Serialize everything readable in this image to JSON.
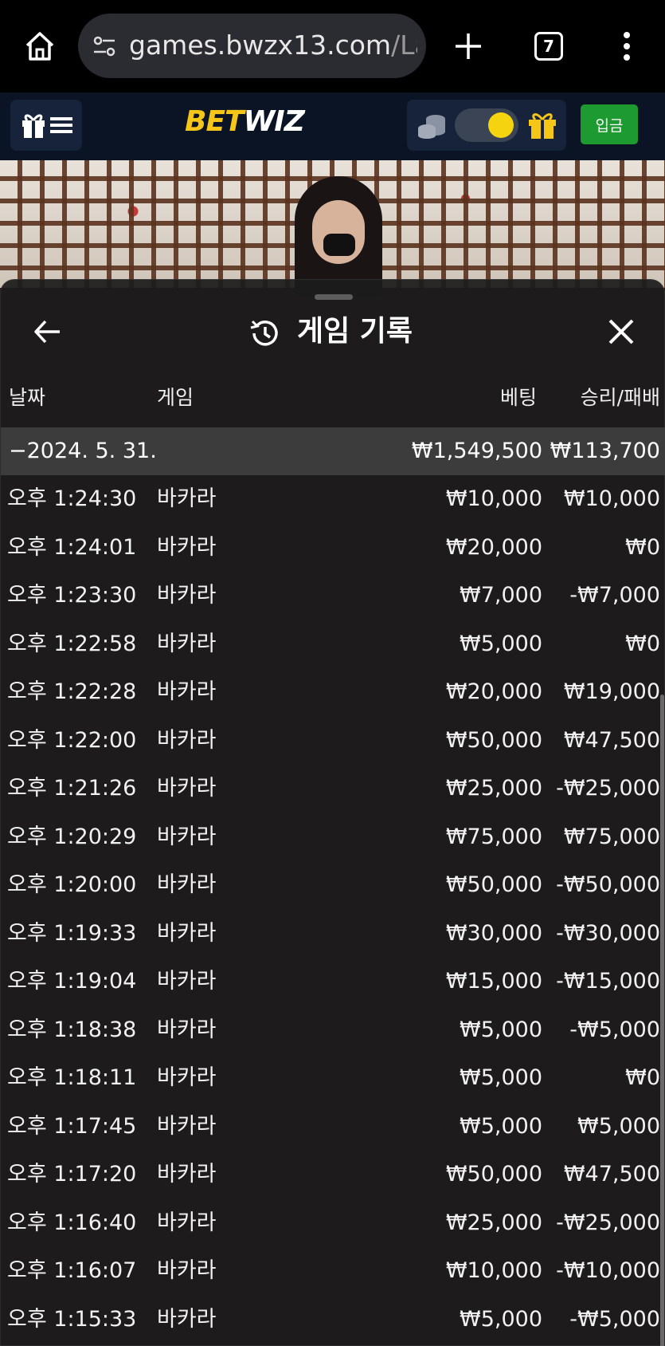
{
  "browser": {
    "url_main": "games.bwzx13.com",
    "url_rest": "/La",
    "tab_count": "7"
  },
  "site": {
    "logo_bet": "BET",
    "logo_wiz": "WIZ",
    "deposit_label": "입금"
  },
  "panel": {
    "title": "게임 기록",
    "headers": {
      "date": "날짜",
      "game": "게임",
      "bet": "베팅",
      "result": "승리/패배"
    },
    "summary": {
      "date": "−2024. 5. 31.",
      "bet": "₩1,549,500",
      "result": "₩113,700"
    },
    "rows": [
      {
        "time": "오후 1:24:30",
        "game": "바카라",
        "bet": "₩10,000",
        "result": "₩10,000"
      },
      {
        "time": "오후 1:24:01",
        "game": "바카라",
        "bet": "₩20,000",
        "result": "₩0"
      },
      {
        "time": "오후 1:23:30",
        "game": "바카라",
        "bet": "₩7,000",
        "result": "-₩7,000"
      },
      {
        "time": "오후 1:22:58",
        "game": "바카라",
        "bet": "₩5,000",
        "result": "₩0"
      },
      {
        "time": "오후 1:22:28",
        "game": "바카라",
        "bet": "₩20,000",
        "result": "₩19,000"
      },
      {
        "time": "오후 1:22:00",
        "game": "바카라",
        "bet": "₩50,000",
        "result": "₩47,500"
      },
      {
        "time": "오후 1:21:26",
        "game": "바카라",
        "bet": "₩25,000",
        "result": "-₩25,000"
      },
      {
        "time": "오후 1:20:29",
        "game": "바카라",
        "bet": "₩75,000",
        "result": "₩75,000"
      },
      {
        "time": "오후 1:20:00",
        "game": "바카라",
        "bet": "₩50,000",
        "result": "-₩50,000"
      },
      {
        "time": "오후 1:19:33",
        "game": "바카라",
        "bet": "₩30,000",
        "result": "-₩30,000"
      },
      {
        "time": "오후 1:19:04",
        "game": "바카라",
        "bet": "₩15,000",
        "result": "-₩15,000"
      },
      {
        "time": "오후 1:18:38",
        "game": "바카라",
        "bet": "₩5,000",
        "result": "-₩5,000"
      },
      {
        "time": "오후 1:18:11",
        "game": "바카라",
        "bet": "₩5,000",
        "result": "₩0"
      },
      {
        "time": "오후 1:17:45",
        "game": "바카라",
        "bet": "₩5,000",
        "result": "₩5,000"
      },
      {
        "time": "오후 1:17:20",
        "game": "바카라",
        "bet": "₩50,000",
        "result": "₩47,500"
      },
      {
        "time": "오후 1:16:40",
        "game": "바카라",
        "bet": "₩25,000",
        "result": "-₩25,000"
      },
      {
        "time": "오후 1:16:07",
        "game": "바카라",
        "bet": "₩10,000",
        "result": "-₩10,000"
      },
      {
        "time": "오후 1:15:33",
        "game": "바카라",
        "bet": "₩5,000",
        "result": "-₩5,000"
      }
    ]
  },
  "colors": {
    "logo_accent": "#f5c518",
    "deposit_green": "#1d9b31",
    "header_bg": "#0a1424",
    "toggle_knob": "#f5d40f"
  },
  "icons": {
    "home": "home-icon",
    "tune": "site-settings-icon",
    "plus": "new-tab-icon",
    "menu": "more-vert-icon",
    "gift": "gift-icon",
    "coins": "coins-icon",
    "back": "arrow-left-icon",
    "history": "history-icon",
    "close": "close-icon"
  }
}
